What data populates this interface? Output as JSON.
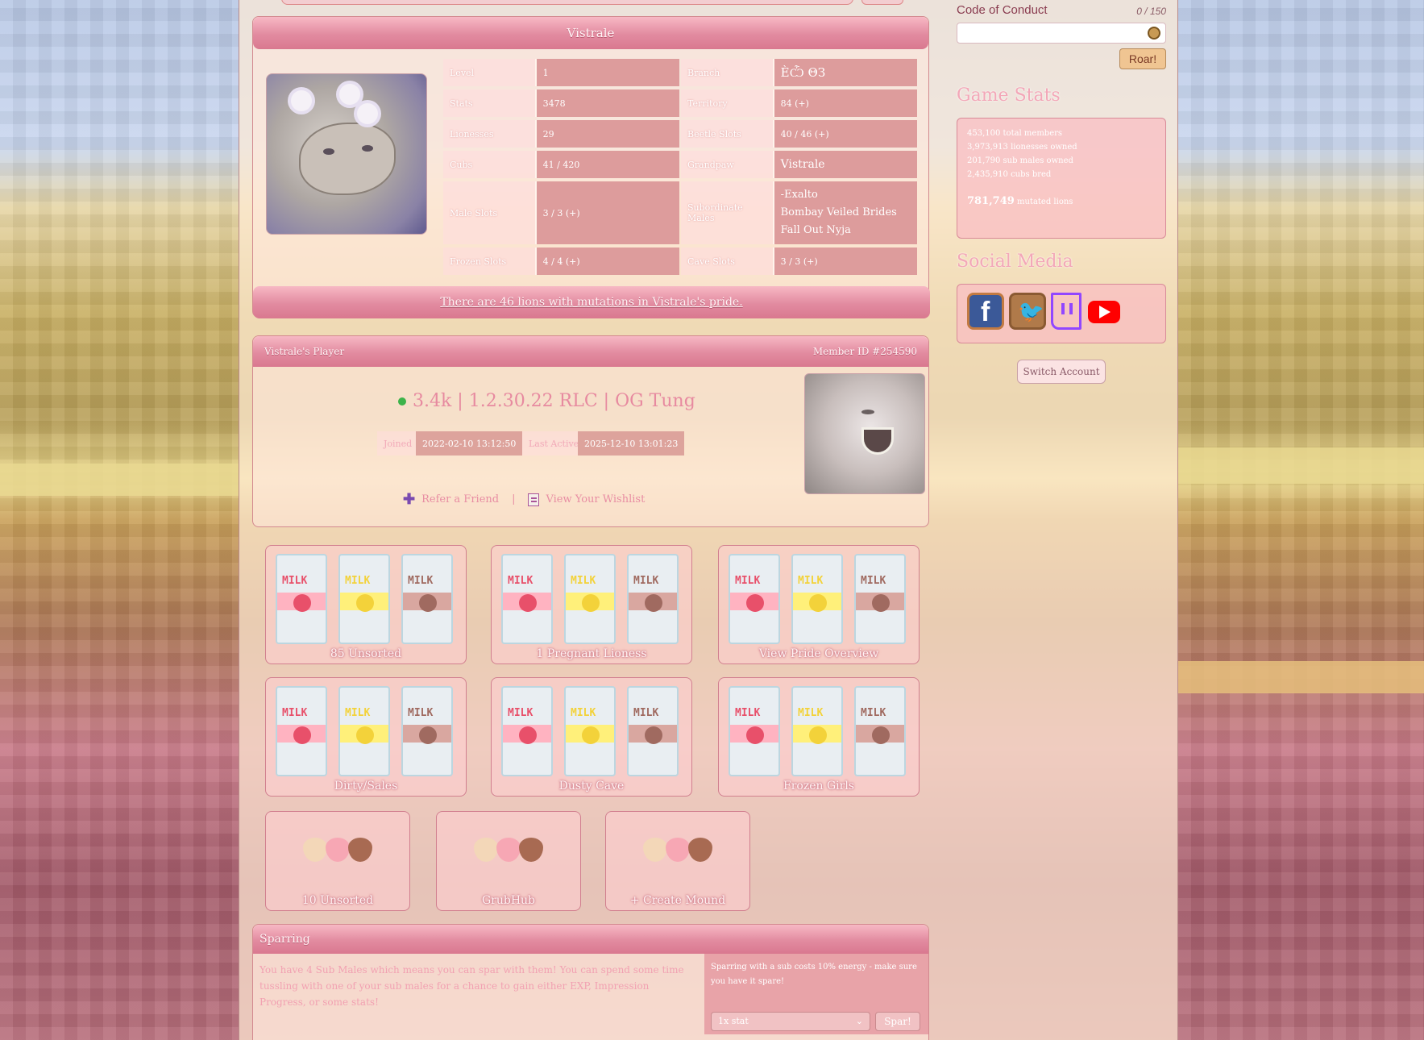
{
  "pride": {
    "name": "Vistrale",
    "stats": [
      {
        "label": "Level",
        "value": "1",
        "label2": "Branch",
        "value2": "ÈѼ ΘЗ"
      },
      {
        "label": "Stats",
        "value": "3478",
        "label2": "Territory",
        "value2": "84 (+)"
      },
      {
        "label": "Lionesses",
        "value": "29",
        "label2": "Beetle Slots",
        "value2": "40 / 46 (+)"
      },
      {
        "label": "Cubs",
        "value": "41 / 420",
        "label2": "Grandpaw",
        "value2": "Vistrale"
      },
      {
        "label": "Frozen Slots",
        "value": "4 / 4 (+)",
        "label2": "Cave Slots",
        "value2": "3 / 3 (+)"
      }
    ],
    "male_slots_label": "Male Slots",
    "male_slots_value": "3 / 3 (+)",
    "subordinate_label": "Subordinate Males",
    "subordinate_males": [
      "-Exalto",
      "Bombay Veiled Brides",
      "Fall Out Nyja"
    ],
    "mutation_link": "There are 46 lions with mutations in Vistrale's pride."
  },
  "player": {
    "header_left": "Vistrale's Player",
    "header_right": "Member ID #254590",
    "name": "3.4k | 1.2.30.22 RLC | OG Tung",
    "joined_label": "Joined",
    "joined_value": "2022-02-10 13:12:50",
    "last_active_label": "Last Active",
    "last_active_value": "2025-12-10 13:01:23",
    "refer_label": "Refer a Friend",
    "separator": "|",
    "wishlist_label": "View Your Wishlist"
  },
  "tiles_row1": [
    "85 Unsorted",
    "1 Pregnant Lioness",
    "View Pride Overview"
  ],
  "tiles_row2": [
    "Dirty/Sales",
    "Dusty Cave",
    "Frozen Girls"
  ],
  "tiles_row3": [
    "10 Unsorted",
    "GrubHub",
    "+ Create Mound"
  ],
  "milk_text": "MILK",
  "sparring": {
    "title": "Sparring",
    "description": "You have 4 Sub Males which means you can spar with them! You can spend some time tussling with one of your sub males for a chance to gain either EXP, Impression Progress, or some stats!",
    "note": "Sparring with a sub costs 10% energy - make sure you have it spare!",
    "select_value": "1x stat",
    "button": "Spar!"
  },
  "sidebar": {
    "coc_title": "Code of Conduct",
    "coc_count": "0 / 150",
    "roar_button": "Roar!",
    "game_stats_title": "Game Stats",
    "game_stats": [
      "453,100 total members",
      "3,973,913 lionesses owned",
      "201,790 sub males owned",
      "2,435,910 cubs bred"
    ],
    "mutated_count": "781,749",
    "mutated_label": "mutated lions",
    "social_title": "Social Media",
    "switch_account": "Switch Account"
  },
  "colors": {
    "accent": "#e28ba0",
    "panel_border": "#d3898f",
    "online": "#3cb34a",
    "facebook": "#3b5998",
    "twitter": "#b07a4a",
    "twitch": "#9146ff",
    "youtube": "#ff0000"
  },
  "icons": [
    "lion-icon",
    "plus-icon",
    "list-icon",
    "facebook-icon",
    "twitter-icon",
    "twitch-icon",
    "youtube-icon",
    "chevron-down-icon"
  ]
}
